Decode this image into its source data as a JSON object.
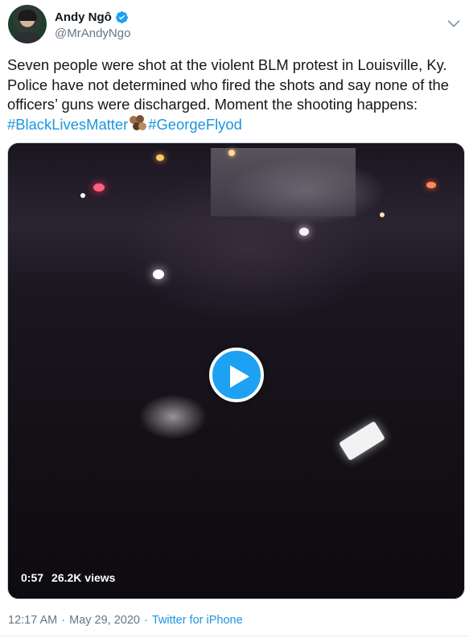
{
  "author": {
    "display_name": "Andy Ngô",
    "handle": "@MrAndyNgo",
    "verified": true
  },
  "tweet": {
    "text": "Seven people were shot at the violent BLM protest in Louisville, Ky. Police have not determined who fired the shots and say none of the officers’ guns were discharged. Moment the shooting happens: ",
    "hashtags": [
      "#BlackLivesMatter",
      "#GeorgeFlyod"
    ],
    "emoji": "raised-fists-skin-tones"
  },
  "video": {
    "duration": "0:57",
    "views": "26.2K views"
  },
  "meta": {
    "time": "12:17 AM",
    "separator": "·",
    "date": "May 29, 2020",
    "source": "Twitter for iPhone"
  },
  "colors": {
    "link": "#1b95e0",
    "verified": "#1da1f2",
    "secondary_text": "#657786"
  },
  "icons": [
    "verified-badge-icon",
    "chevron-down-icon",
    "play-icon"
  ]
}
